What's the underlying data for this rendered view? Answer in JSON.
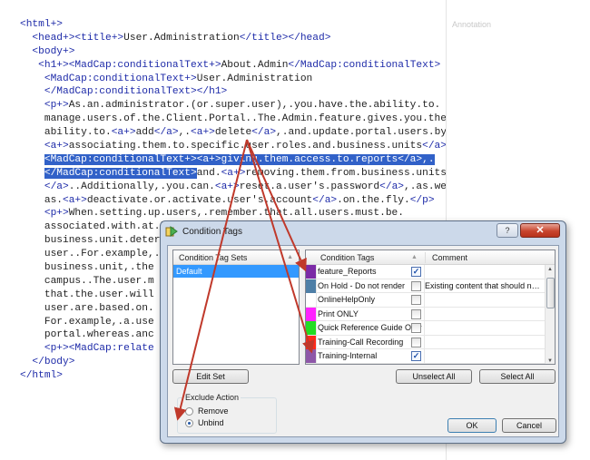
{
  "editor": {
    "lines": [
      [
        {
          "c": "tg",
          "t": "<html+>"
        }
      ],
      [
        {
          "c": "tg",
          "t": "  <head+><title+>"
        },
        {
          "c": "tx",
          "t": "User.Administration"
        },
        {
          "c": "tg",
          "t": "</title></head>"
        }
      ],
      [
        {
          "c": "tg",
          "t": "  <body+>"
        }
      ],
      [
        {
          "c": "tg",
          "t": "   <h1+><MadCap:conditionalText+>"
        },
        {
          "c": "tx",
          "t": "About.Admin"
        },
        {
          "c": "tg",
          "t": "</MadCap:conditionalText>"
        }
      ],
      [
        {
          "c": "tg",
          "t": "    <MadCap:conditionalText+>"
        },
        {
          "c": "tx",
          "t": "User.Administration"
        }
      ],
      [
        {
          "c": "tg",
          "t": "    </MadCap:conditionalText></h1>"
        }
      ],
      [
        {
          "c": "tg",
          "t": "    <p+>"
        },
        {
          "c": "tx",
          "t": "As.an.administrator.(or.super.user),.you.have.the.ability.to."
        }
      ],
      [
        {
          "c": "tx",
          "t": "    manage.users.of.the.Client.Portal..The.Admin.feature.gives.you.the."
        }
      ],
      [
        {
          "c": "tx",
          "t": "    ability.to."
        },
        {
          "c": "tg",
          "t": "<a+>"
        },
        {
          "c": "tx",
          "t": "add"
        },
        {
          "c": "tg",
          "t": "</a>"
        },
        {
          "c": "tx",
          "t": ",."
        },
        {
          "c": "tg",
          "t": "<a+>"
        },
        {
          "c": "tx",
          "t": "delete"
        },
        {
          "c": "tg",
          "t": "</a>"
        },
        {
          "c": "tx",
          "t": ",.and.update.portal.users.by."
        }
      ],
      [
        {
          "c": "tx",
          "t": "    "
        },
        {
          "c": "tg",
          "t": "<a+>"
        },
        {
          "c": "tx",
          "t": "associating.them.to.specific.user.roles.and.business.units"
        },
        {
          "c": "tg",
          "t": "</a>"
        },
        {
          "c": "tx",
          "t": ",."
        }
      ],
      [
        {
          "c": "tx",
          "t": "    "
        },
        {
          "c": "hl",
          "t": "<MadCap:conditionalText+><a+>giving.them.access.to.reports</a>,."
        }
      ],
      [
        {
          "c": "tx",
          "t": "    "
        },
        {
          "c": "hl",
          "t": "</MadCap:conditionalText>"
        },
        {
          "c": "tx",
          "t": "and."
        },
        {
          "c": "tg",
          "t": "<a+>"
        },
        {
          "c": "tx",
          "t": "removing.them.from.business.units"
        }
      ],
      [
        {
          "c": "tg",
          "t": "    </a>"
        },
        {
          "c": "tx",
          "t": "..Additionally,.you.can."
        },
        {
          "c": "tg",
          "t": "<a+>"
        },
        {
          "c": "tx",
          "t": "reset.a.user's.password"
        },
        {
          "c": "tg",
          "t": "</a>"
        },
        {
          "c": "tx",
          "t": ",.as.well."
        }
      ],
      [
        {
          "c": "tx",
          "t": "    as."
        },
        {
          "c": "tg",
          "t": "<a+>"
        },
        {
          "c": "tx",
          "t": "deactivate.or.activate.user's.account"
        },
        {
          "c": "tg",
          "t": "</a>"
        },
        {
          "c": "tx",
          "t": ".on.the.fly."
        },
        {
          "c": "tg",
          "t": "</p>"
        }
      ],
      [
        {
          "c": "tg",
          "t": "    <p+>"
        },
        {
          "c": "tx",
          "t": "When.setting.up.users,.remember.that.all.users.must.be."
        }
      ],
      [
        {
          "c": "tx",
          "t": "    associated.with.at.least.one.business.unit.and.one.user.role..The."
        }
      ],
      [
        {
          "c": "tx",
          "t": "    business.unit.determines.the.level.of.information.available.to.the."
        }
      ],
      [
        {
          "c": "tx",
          "t": "    user..For.example,.if.a.user.is.associated.with.one.campus.for.a."
        }
      ],
      [
        {
          "c": "tx",
          "t": "    business.unit,.the"
        }
      ],
      [
        {
          "c": "tx",
          "t": "    campus..The.user.m"
        }
      ],
      [
        {
          "c": "tx",
          "t": "    that.the.user.will"
        }
      ],
      [
        {
          "c": "tx",
          "t": "    user.are.based.on."
        }
      ],
      [
        {
          "c": "tx",
          "t": "    For.example,.a.use"
        }
      ],
      [
        {
          "c": "tx",
          "t": "    portal.whereas.anc"
        }
      ],
      [
        {
          "c": "tg",
          "t": "    <p+><MadCap:relate"
        }
      ],
      [
        {
          "c": "tg",
          "t": "  </body>"
        }
      ],
      [
        {
          "c": "tg",
          "t": "</html>"
        }
      ]
    ]
  },
  "annotation_label": "Annotation",
  "dialog": {
    "title": "Condition Tags",
    "help_label": "?",
    "close_label": "✕",
    "tagsets_header": "Condition Tag Sets",
    "tagsets": [
      "Default"
    ],
    "tags_header": "Condition Tags",
    "comment_header": "Comment",
    "sort_arrow": "▲",
    "tags": [
      {
        "name": "feature_Reports",
        "color": "#7b2aa6",
        "checked": true,
        "comment": ""
      },
      {
        "name": "On Hold - Do not render",
        "color": "#4e7fa7",
        "checked": false,
        "comment": "Existing content that should not be..."
      },
      {
        "name": "OnlineHelpOnly",
        "color": "#ffffff",
        "checked": false,
        "comment": ""
      },
      {
        "name": "Print ONLY",
        "color": "#ff22ff",
        "checked": false,
        "comment": ""
      },
      {
        "name": "Quick Reference Guide Only",
        "color": "#22dd22",
        "checked": false,
        "comment": ""
      },
      {
        "name": "Training-Call Recording",
        "color": "#ff2a1a",
        "checked": false,
        "comment": ""
      },
      {
        "name": "Training-Internal",
        "color": "#8e57a8",
        "checked": true,
        "comment": ""
      }
    ],
    "check_mark": "✓",
    "edit_set_label": "Edit Set",
    "unselect_all_label": "Unselect All",
    "select_all_label": "Select All",
    "exclude_action_label": "Exclude Action",
    "remove_label": "Remove",
    "unbind_label": "Unbind",
    "exclude_action_value": "Unbind",
    "ok_label": "OK",
    "cancel_label": "Cancel"
  },
  "colors": {
    "arrow": "#c0392b",
    "selection": "#3161c8",
    "list_selection": "#3399ff"
  }
}
